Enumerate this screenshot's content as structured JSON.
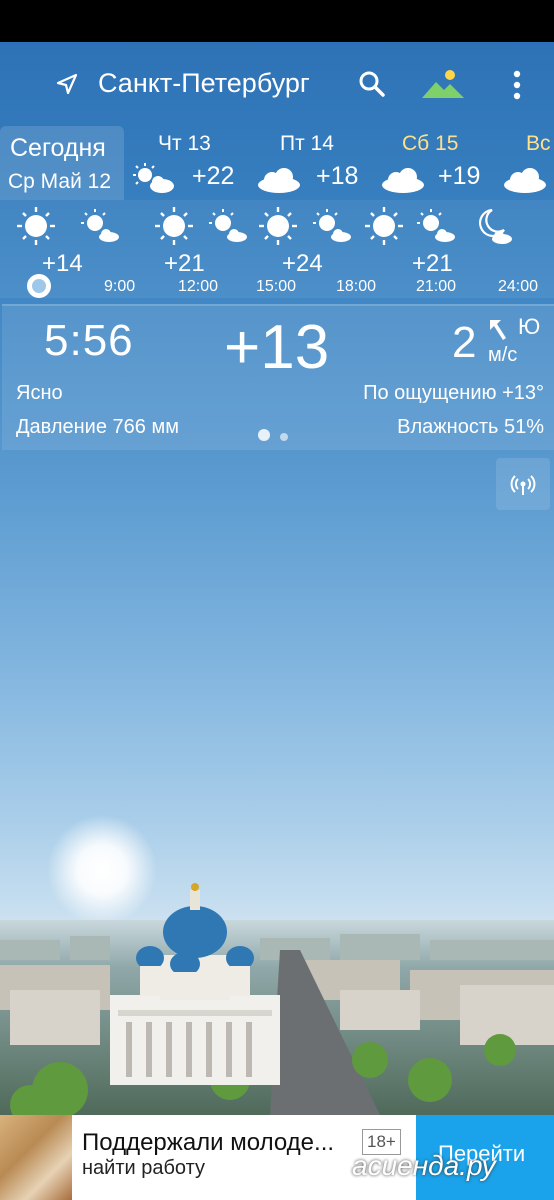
{
  "header": {
    "city": "Санкт-Петербург",
    "icons": [
      "location-arrow-icon",
      "search-icon",
      "landscape-icon",
      "more-vert-icon"
    ]
  },
  "days": {
    "today": {
      "title": "Сегодня",
      "date": "Ср Май 12"
    },
    "items": [
      {
        "name": "Чт 13",
        "temp": "+22",
        "icon": "sun-cloud-icon"
      },
      {
        "name": "Пт 14",
        "temp": "+18",
        "icon": "cloud-icon"
      },
      {
        "name": "Сб 15",
        "temp": "+19",
        "icon": "cloud-icon",
        "color": "#ffe08a"
      },
      {
        "name": "Вс",
        "temp": "",
        "icon": "cloud-icon"
      }
    ]
  },
  "hourly": {
    "temps": [
      "+14",
      "+21",
      "+24",
      "+21"
    ],
    "times": [
      "9:00",
      "12:00",
      "15:00",
      "18:00",
      "21:00",
      "24:00"
    ],
    "icons": [
      "sun-icon",
      "sun-cloud-icon",
      "sun-icon",
      "sun-cloud-icon",
      "sun-icon",
      "sun-cloud-icon",
      "sun-icon",
      "sun-cloud-icon",
      "moon-cloud-icon"
    ]
  },
  "current": {
    "time": "5:56",
    "temp": "+13",
    "wind_speed": "2",
    "wind_dir": "Ю",
    "wind_unit": "м/с",
    "condition": "Ясно",
    "feels_like": "По ощущению +13°",
    "pressure": "Давление 766 мм",
    "humidity": "Влажность 51%",
    "page_indicator": {
      "pages": 2,
      "active": 1
    }
  },
  "ad": {
    "title": "Поддержали молоде...",
    "subtitle": "найти работу",
    "age": "18+",
    "button": "Перейти"
  },
  "watermark": "асиенда.ру"
}
